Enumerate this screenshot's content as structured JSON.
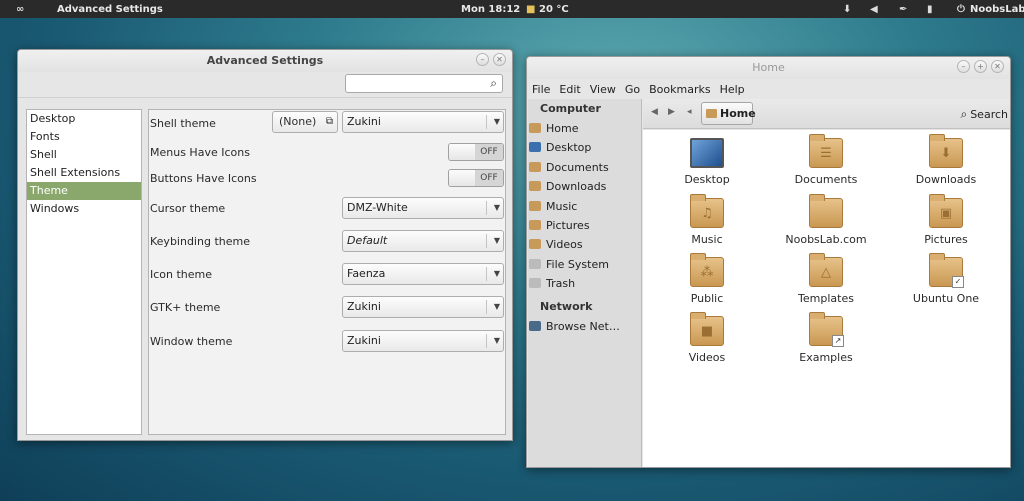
{
  "top_panel": {
    "app_name": "Advanced Settings",
    "clock": "Mon 18:12",
    "weather": "20 °C",
    "user": "NoobsLab",
    "icons": [
      "activities-icon",
      "updates-icon",
      "volume-icon",
      "bluetooth-icon",
      "battery-icon",
      "power-icon"
    ]
  },
  "advanced": {
    "title": "Advanced Settings",
    "search_value": "",
    "sidebar": [
      {
        "label": "Desktop"
      },
      {
        "label": "Fonts"
      },
      {
        "label": "Shell"
      },
      {
        "label": "Shell Extensions"
      },
      {
        "label": "Theme",
        "selected": true
      },
      {
        "label": "Windows"
      }
    ],
    "rows": {
      "shell_theme": {
        "label": "Shell theme",
        "none_label": "(None)",
        "value": "Zukini"
      },
      "menus_icons": {
        "label": "Menus Have Icons",
        "state": "OFF"
      },
      "buttons_icons": {
        "label": "Buttons Have Icons",
        "state": "OFF"
      },
      "cursor_theme": {
        "label": "Cursor theme",
        "value": "DMZ-White"
      },
      "keybinding_theme": {
        "label": "Keybinding theme",
        "value": "Default"
      },
      "icon_theme": {
        "label": "Icon theme",
        "value": "Faenza"
      },
      "gtk_theme": {
        "label": "GTK+ theme",
        "value": "Zukini"
      },
      "window_theme": {
        "label": "Window theme",
        "value": "Zukini"
      }
    }
  },
  "home": {
    "title": "Home",
    "menu": [
      "File",
      "Edit",
      "View",
      "Go",
      "Bookmarks",
      "Help"
    ],
    "computer_header": "Computer",
    "places": [
      "Home",
      "Desktop",
      "Documents",
      "Downloads",
      "Music",
      "Pictures",
      "Videos",
      "File System",
      "Trash"
    ],
    "network_header": "Network",
    "network_items": [
      "Browse Net…"
    ],
    "breadcrumb": "Home",
    "search_label": "Search",
    "files": [
      "Desktop",
      "Documents",
      "Downloads",
      "Music",
      "NoobsLab.com",
      "Pictures",
      "Public",
      "Templates",
      "Ubuntu One",
      "Videos",
      "Examples"
    ]
  },
  "colors": {
    "selection": "#8aa86b",
    "folder": "#c99852",
    "panel": "#2a2a2a"
  }
}
